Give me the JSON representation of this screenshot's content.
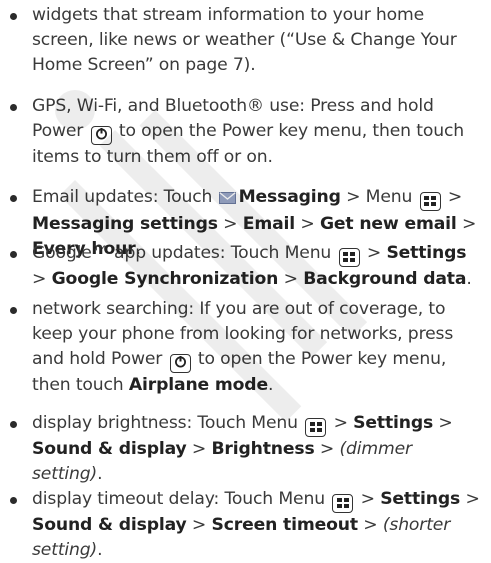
{
  "icons": {
    "power": "power-key-icon",
    "menu": "menu-key-icon",
    "envelope": "messaging-envelope-icon",
    "watermark": "draft-watermark"
  },
  "items": {
    "widgets": {
      "text": "widgets that stream information to your home screen, like news or weather (“Use & Change Your Home Screen” on page 7)."
    },
    "gps": {
      "a": "GPS, Wi-Fi, and Bluetooth® use: Press and hold Power",
      "b": "to open the Power key menu, then touch items to turn them off or on."
    },
    "email": {
      "a": "Email updates: Touch",
      "messaging": "Messaging",
      "b": "> Menu",
      "c": ">",
      "messaging_settings": "Messaging settings",
      "d": ">",
      "email": "Email",
      "e": ">",
      "get_new_email": "Get new email",
      "f": ">",
      "every_hour": "Every hour",
      "g": "."
    },
    "google": {
      "a": "Google™ app updates: Touch Menu",
      "b": ">",
      "settings": "Settings",
      "c": ">",
      "google_sync": "Google Synchronization",
      "d": ">",
      "background_data": "Background data",
      "e": "."
    },
    "network": {
      "a": "network searching: If you are out of coverage, to keep your phone from looking for networks, press and hold Power",
      "b": "to open the Power key menu, then touch",
      "airplane_mode": "Airplane mode",
      "c": "."
    },
    "brightness": {
      "a": "display brightness: Touch Menu",
      "b": ">",
      "settings": "Settings",
      "c": ">",
      "sound_display": "Sound & display",
      "d": ">",
      "brightness": "Brightness",
      "e": ">",
      "dimmer": "(dimmer setting)",
      "f": "."
    },
    "timeout": {
      "a": "display timeout delay: Touch Menu",
      "b": ">",
      "settings": "Settings",
      "c": ">",
      "sound_display": "Sound & display",
      "d": ">",
      "screen_timeout": "Screen timeout",
      "e": ">",
      "shorter": "(shorter setting)",
      "f": "."
    }
  }
}
